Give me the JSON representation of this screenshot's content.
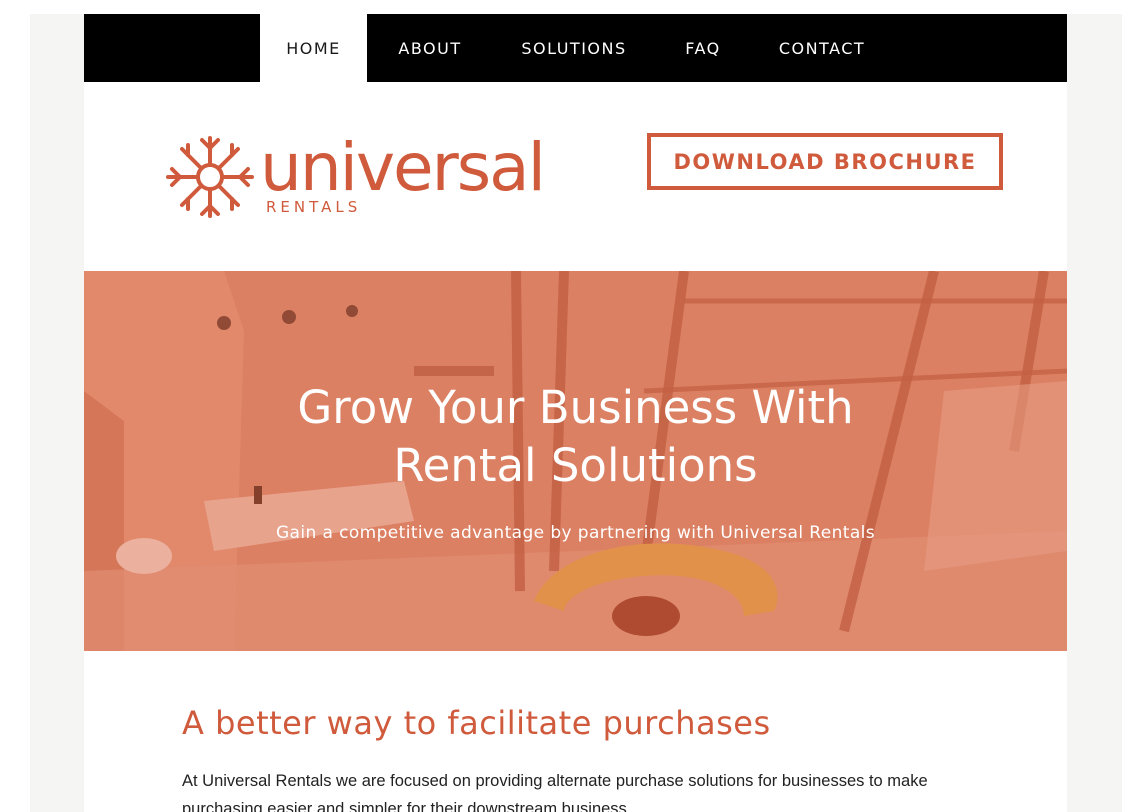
{
  "nav": {
    "items": [
      {
        "label": "HOME",
        "active": true
      },
      {
        "label": "ABOUT",
        "active": false
      },
      {
        "label": "SOLUTIONS",
        "active": false
      },
      {
        "label": "FAQ",
        "active": false
      },
      {
        "label": "CONTACT",
        "active": false
      }
    ]
  },
  "header": {
    "logo_text": "universal",
    "logo_subtext": "RENTALS",
    "logo_icon": "sunburst-icon",
    "brochure_button": "DOWNLOAD BROCHURE"
  },
  "hero": {
    "title_line1": "Grow Your Business With",
    "title_line2": "Rental Solutions",
    "subtitle": "Gain a competitive advantage by partnering with Universal Rentals"
  },
  "content": {
    "title": "A better way to facilitate purchases",
    "paragraph": "At Universal Rentals we are focused on providing alternate purchase solutions for businesses to make purchasing easier and simpler for their downstream business"
  },
  "colors": {
    "accent": "#d05a3c",
    "nav_background": "#000000",
    "hero_overlay": "#d98266"
  }
}
